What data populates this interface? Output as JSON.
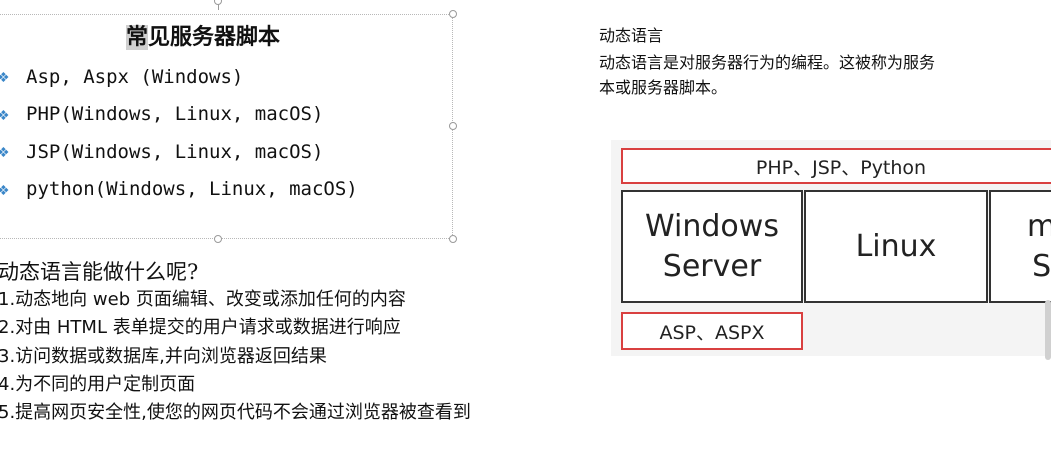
{
  "textbox": {
    "title_first": "常",
    "title_rest": "见服务器脚本",
    "bullet_icon": "diamond-bullet-icon",
    "items": [
      "Asp, Aspx (Windows)",
      "PHP(Windows, Linux, macOS)",
      "JSP(Windows, Linux, macOS)",
      "python(Windows, Linux, macOS)"
    ]
  },
  "question": {
    "title": "动态语言能做什么呢?",
    "items": [
      "1.动态地向 web 页面编辑、改变或添加任何的内容",
      "2.对由 HTML 表单提交的用户请求或数据进行响应",
      "3.访问数据或数据库,并向浏览器返回结果",
      "4.为不同的用户定制页面",
      "5.提高网页安全性,使您的网页代码不会通过浏览器被查看到"
    ]
  },
  "right": {
    "heading": "动态语言",
    "desc_line1": "动态语言是对服务器行为的编程。这被称为服务",
    "desc_line2": "本或服务器脚本。",
    "top_bar": "PHP、JSP、Python",
    "os1_line1": "Windows",
    "os1_line2": "Server",
    "os2": "Linux",
    "os3_line1": "m",
    "os3_line2": "S",
    "bottom_bar": "ASP、ASPX"
  },
  "colors": {
    "bullet": "#3a86c8",
    "red_border": "#d94040"
  }
}
